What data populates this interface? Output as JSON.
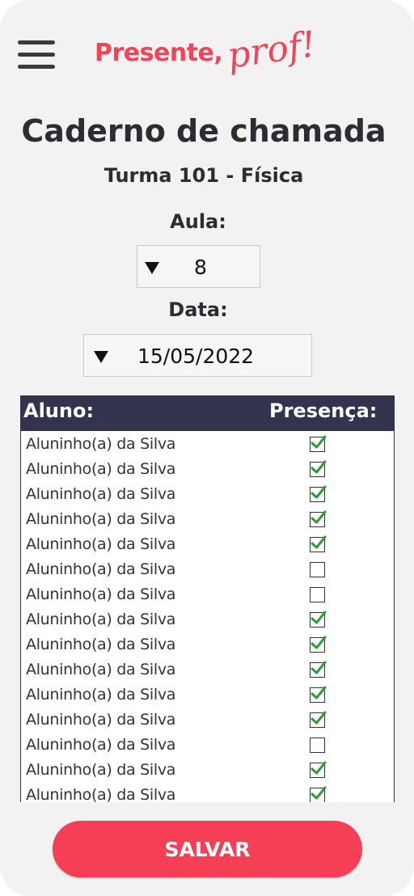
{
  "header": {
    "menu_icon": "hamburger-menu-icon",
    "brand_main": "Presente,",
    "brand_script": "prof!"
  },
  "page": {
    "title": "Caderno de chamada",
    "subtitle": "Turma 101 - Física"
  },
  "filters": {
    "aula_label": "Aula:",
    "aula_value": "8",
    "data_label": "Data:",
    "data_value": "15/05/2022",
    "dropdown_icon": "triangle-down-icon"
  },
  "table": {
    "col_name": "Aluno:",
    "col_presence": "Presença:",
    "rows": [
      {
        "name": "Aluninho(a) da Silva",
        "present": true
      },
      {
        "name": "Aluninho(a) da Silva",
        "present": true
      },
      {
        "name": "Aluninho(a) da Silva",
        "present": true
      },
      {
        "name": "Aluninho(a) da Silva",
        "present": true
      },
      {
        "name": "Aluninho(a) da Silva",
        "present": true
      },
      {
        "name": "Aluninho(a) da Silva",
        "present": false
      },
      {
        "name": "Aluninho(a) da Silva",
        "present": false
      },
      {
        "name": "Aluninho(a) da Silva",
        "present": true
      },
      {
        "name": "Aluninho(a) da Silva",
        "present": true
      },
      {
        "name": "Aluninho(a) da Silva",
        "present": true
      },
      {
        "name": "Aluninho(a) da Silva",
        "present": true
      },
      {
        "name": "Aluninho(a) da Silva",
        "present": true
      },
      {
        "name": "Aluninho(a) da Silva",
        "present": false
      },
      {
        "name": "Aluninho(a) da Silva",
        "present": true
      },
      {
        "name": "Aluninho(a) da Silva",
        "present": true
      }
    ]
  },
  "actions": {
    "save_label": "SALVAR"
  },
  "colors": {
    "brand": "#f04458",
    "header_bg": "#32334c",
    "check": "#2e9a3e",
    "save_bg": "#f43f55"
  }
}
